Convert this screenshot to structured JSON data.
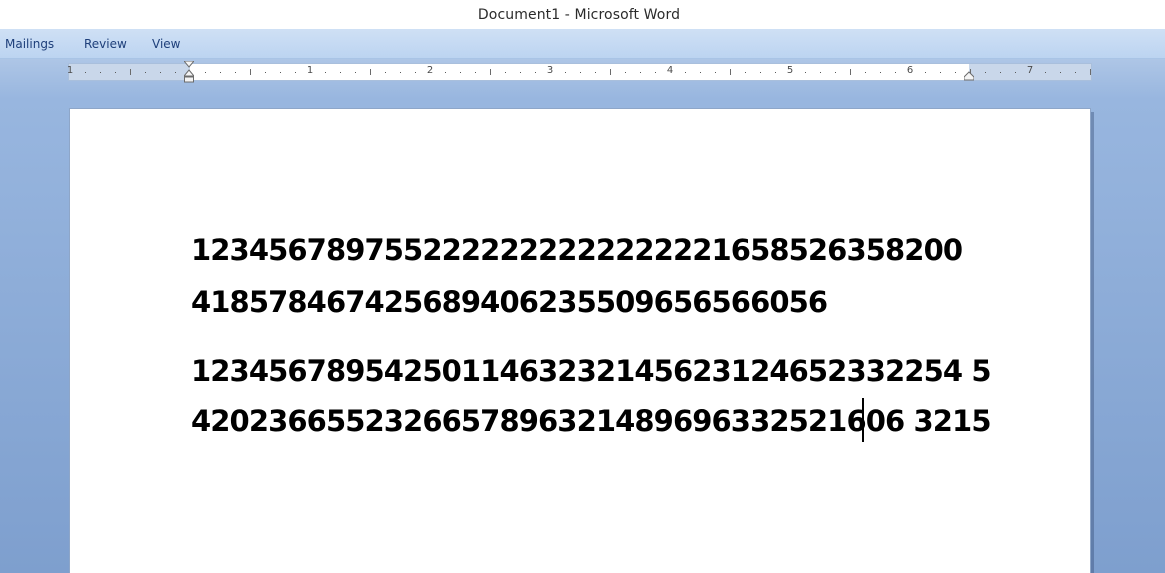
{
  "window": {
    "title": "Document1 - Microsoft Word"
  },
  "menu": {
    "tabs": [
      {
        "label": "Mailings"
      },
      {
        "label": "Review"
      },
      {
        "label": "View"
      }
    ]
  },
  "ruler": {
    "numbers": [
      "1",
      "1",
      "2",
      "3",
      "4",
      "5",
      "6",
      "7"
    ]
  },
  "document": {
    "paragraphs": [
      {
        "lines": [
          "1234567897552222222222222221658526358200",
          "418578467425689406235509656566056"
        ]
      },
      {
        "lines": [
          "1234567895425011463232145623124652332254 5",
          "4202366552326657896321489696332521606 3215"
        ]
      }
    ]
  },
  "colors": {
    "menubar": "#bcd4f1",
    "workspace": "#8eaedb",
    "menu_text": "#1e3f7a"
  }
}
